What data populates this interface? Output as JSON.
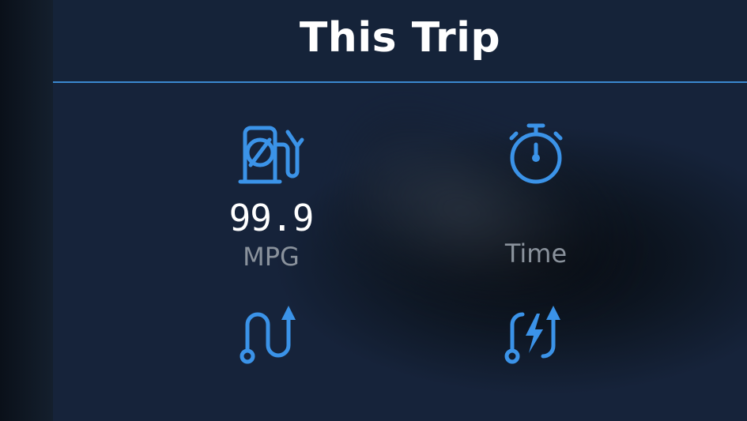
{
  "header": {
    "title": "This Trip"
  },
  "metrics": [
    {
      "id": "mpg",
      "value": "99.9",
      "unit": "MPG",
      "icon": "fuel-pump-icon"
    },
    {
      "id": "time",
      "value": "",
      "unit": "Time",
      "icon": "stopwatch-icon"
    },
    {
      "id": "distance",
      "value": "",
      "unit": "",
      "icon": "route-icon"
    },
    {
      "id": "ev",
      "value": "",
      "unit": "",
      "icon": "electric-route-icon"
    }
  ],
  "colors": {
    "accent": "#3b93e8",
    "header_bg": "#152339",
    "header_border": "#3b88cf",
    "value_text": "#ffffff",
    "unit_text": "#8a929c"
  }
}
